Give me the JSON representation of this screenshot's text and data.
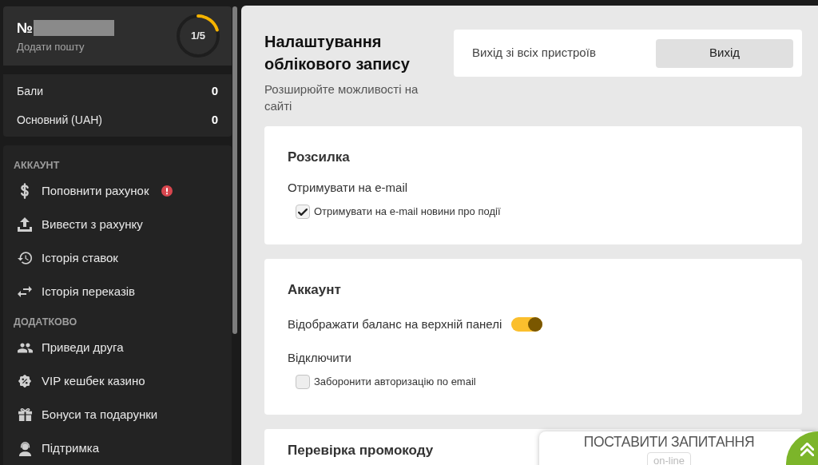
{
  "sidebar": {
    "profile": {
      "number_label": "№",
      "add_email_link": "Додати пошту",
      "progress": {
        "text": "1/5",
        "level": 0.2
      }
    },
    "balances": [
      {
        "label": "Бали",
        "value": "0"
      },
      {
        "label": "Основний (UAH)",
        "value": "0"
      }
    ],
    "sections": [
      {
        "title": "АККАУНТ",
        "items": [
          {
            "label": "Поповнити рахунок",
            "alert": true
          },
          {
            "label": "Вивести з рахунку",
            "alert": false
          },
          {
            "label": "Історія ставок",
            "alert": false
          },
          {
            "label": "Історія переказів",
            "alert": false
          }
        ]
      },
      {
        "title": "ДОДАТКОВО",
        "items": [
          {
            "label": "Приведи друга",
            "alert": false
          },
          {
            "label": "VIP кешбек казино",
            "alert": false
          },
          {
            "label": "Бонуси та подарунки",
            "alert": false
          },
          {
            "label": "Підтримка",
            "alert": false
          }
        ]
      }
    ]
  },
  "main": {
    "header": {
      "title": "Налаштування облікового запису",
      "subtitle": "Розширюйте можливості на сайті"
    },
    "logout_card": {
      "text": "Вихід зі всіх пристроїв",
      "button": "Вихід"
    },
    "cards": [
      {
        "title": "Розсилка",
        "rows": [
          {
            "kind": "label",
            "text": "Отримувати на e-mail"
          },
          {
            "kind": "checkbox",
            "label": "Отримувати на e-mail новини про події",
            "checked": true
          }
        ]
      },
      {
        "title": "Аккаунт",
        "rows": [
          {
            "kind": "toggle",
            "label": "Відображати баланс на верхній панелі",
            "on": true
          },
          {
            "kind": "label",
            "text": "Відключити"
          },
          {
            "kind": "checkbox",
            "label": "Заборонити авторизацію по email",
            "checked": false
          }
        ]
      },
      {
        "title": "Перевірка промокоду"
      }
    ]
  },
  "chat_widget": {
    "title": "ПОСТАВИТИ ЗАПИТАННЯ",
    "status": "on-line"
  }
}
